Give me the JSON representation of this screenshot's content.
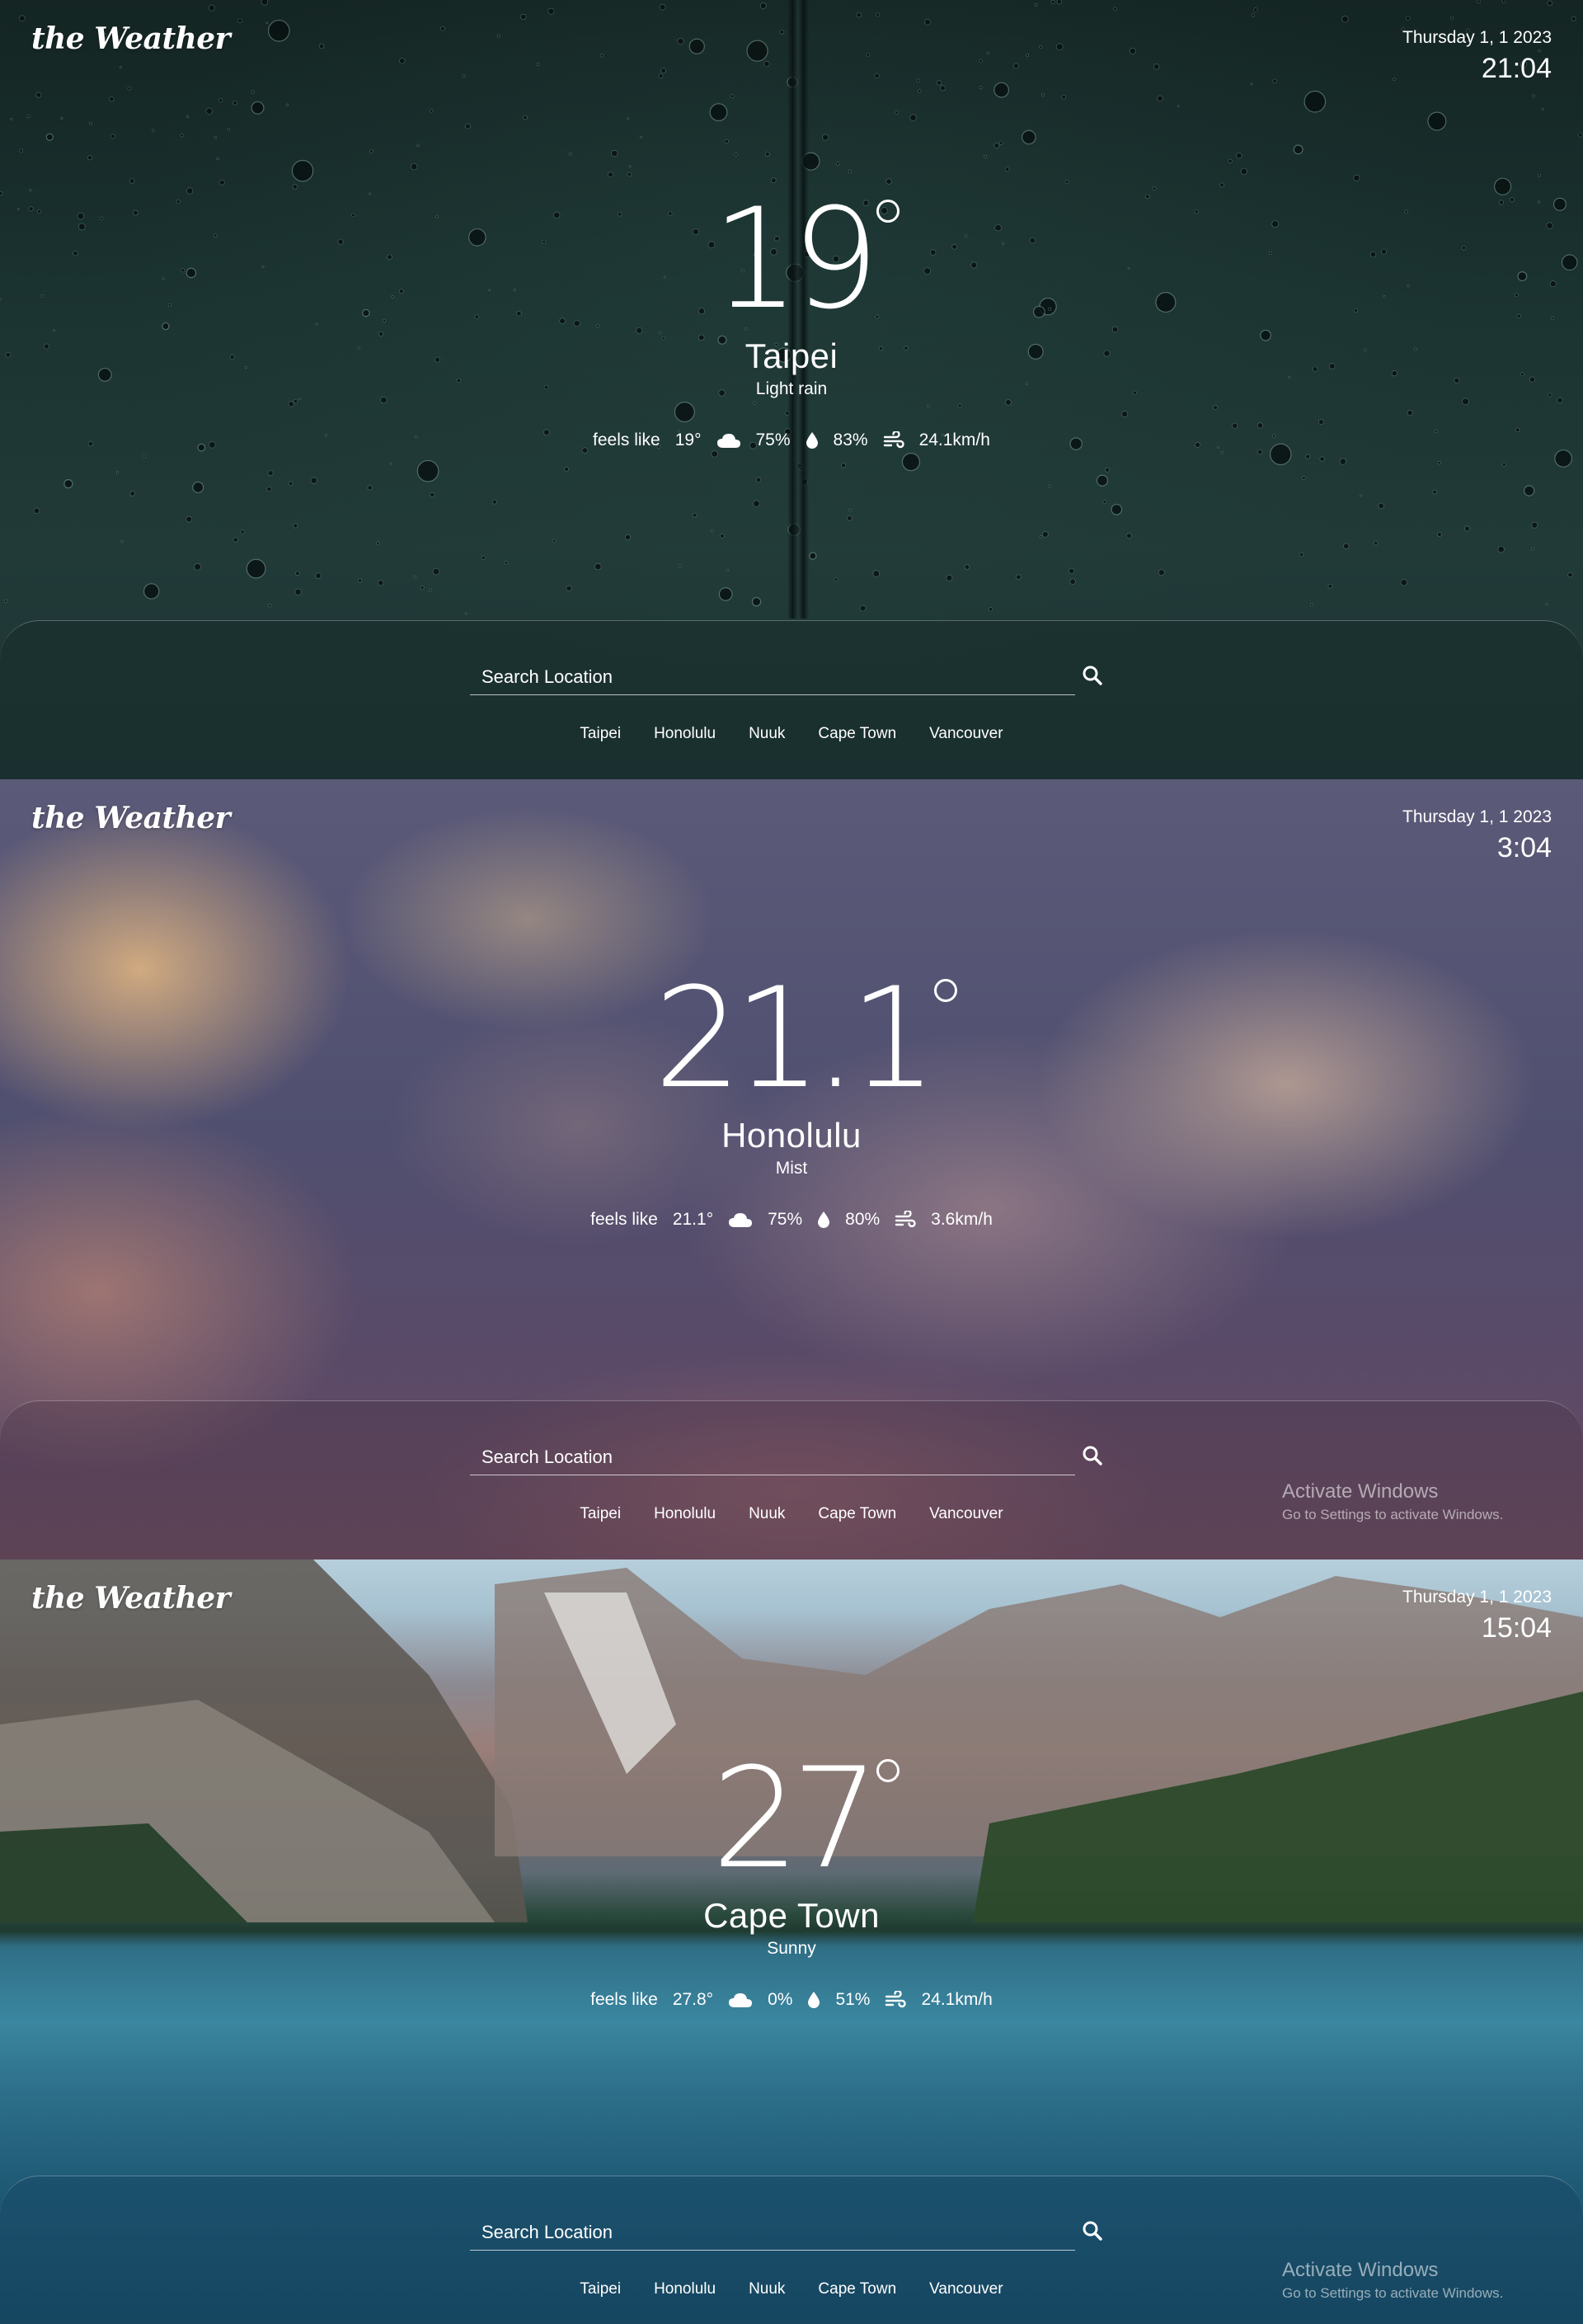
{
  "app": {
    "logo": "the Weather"
  },
  "screens": [
    {
      "date": "Thursday 1, 1 2023",
      "time": "21:04",
      "temperature": "19",
      "city": "Taipei",
      "condition": "Light rain",
      "feels_like_label": "feels like",
      "feels_like": "19°",
      "cloudiness": "75%",
      "humidity": "83%",
      "wind": "24.1km/h",
      "background": "rain-drops-on-glass"
    },
    {
      "date": "Thursday 1, 1 2023",
      "time": "3:04",
      "temperature": "21.1",
      "city": "Honolulu",
      "condition": "Mist",
      "feels_like_label": "feels like",
      "feels_like": "21.1°",
      "cloudiness": "75%",
      "humidity": "80%",
      "wind": "3.6km/h",
      "background": "sunset-clouds"
    },
    {
      "date": "Thursday 1, 1 2023",
      "time": "15:04",
      "temperature": "27",
      "city": "Cape Town",
      "condition": "Sunny",
      "feels_like_label": "feels like",
      "feels_like": "27.8°",
      "cloudiness": "0%",
      "humidity": "51%",
      "wind": "24.1km/h",
      "background": "mountain-lake"
    }
  ],
  "search": {
    "placeholder": "Search Location"
  },
  "quick_cities": [
    "Taipei",
    "Honolulu",
    "Nuuk",
    "Cape Town",
    "Vancouver"
  ],
  "watermark": {
    "title": "Activate Windows",
    "subtitle": "Go to Settings to activate Windows."
  },
  "icons": {
    "cloud": "cloud-icon",
    "humidity": "water-drop-icon",
    "wind": "wind-icon",
    "search": "search-icon"
  },
  "colors": {
    "text": "#ffffff",
    "rain_bg": "#1b3331",
    "cloud_bg": "#504f70",
    "lake_bg": "#2c6e89"
  }
}
